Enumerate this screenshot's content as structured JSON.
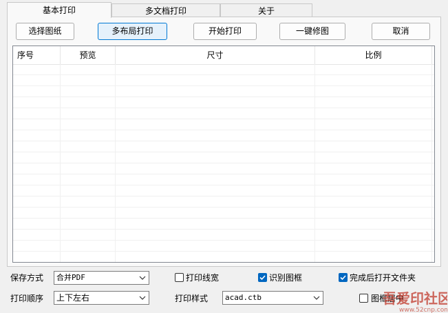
{
  "tabs": [
    {
      "label": "基本打印",
      "active": true
    },
    {
      "label": "多文档打印",
      "active": false
    },
    {
      "label": "关于",
      "active": false
    }
  ],
  "toolbar": {
    "select_sheet": "选择图纸",
    "multi_layout_print": "多布局打印",
    "start_print": "开始打印",
    "one_click_fix": "一键修图",
    "cancel": "取消"
  },
  "table": {
    "columns": [
      "序号",
      "预览",
      "尺寸",
      "比例"
    ],
    "rows": []
  },
  "options": {
    "save_mode_label": "保存方式",
    "save_mode_value": "合并PDF",
    "print_order_label": "打印顺序",
    "print_order_value": "上下左右",
    "print_linewidth_label": "打印线宽",
    "print_linewidth_checked": false,
    "detect_frame_label": "识别图框",
    "detect_frame_checked": true,
    "open_folder_label": "完成后打开文件夹",
    "open_folder_checked": true,
    "print_style_label": "打印样式",
    "print_style_value": "acad.ctb",
    "frame_center_label": "图框居中",
    "frame_center_checked": false
  },
  "watermark": {
    "text": "吾爱印社区",
    "url": "www.52cnp.com"
  },
  "colors": {
    "accent": "#0067c0",
    "primary_button_border": "#0078d4",
    "primary_button_bg": "#e5f1fb",
    "watermark": "#c0392b"
  }
}
